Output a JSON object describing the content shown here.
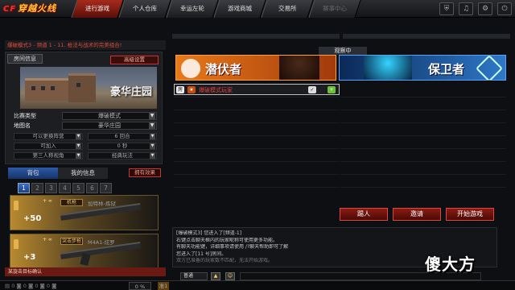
{
  "top_nav": {
    "logo": "穿越火线",
    "tabs": [
      "进行游戏",
      "个人仓库",
      "幸运左轮",
      "游戏商城",
      "交易所",
      "赛事中心"
    ],
    "active_tab": 0,
    "icons": [
      "shield-icon",
      "bell-icon",
      "gear-icon",
      "power-icon"
    ]
  },
  "mode_bar": "爆破模式3 - 频道 1 - 11. 枪法与战术的完美组合!",
  "room": {
    "info_label": "房间信息",
    "advanced_label": "高级设置",
    "map_name": "豪华庄园",
    "rows": [
      {
        "label": "比赛类型",
        "value": "爆破模式"
      },
      {
        "label": "地图名",
        "value": "豪华庄园"
      }
    ],
    "options": [
      [
        "可以更换阵营",
        "6 回合"
      ],
      [
        "可加入",
        "0 秒"
      ],
      [
        "第三人称视角",
        "经典玩法"
      ]
    ]
  },
  "bag": {
    "tab_bag": "背包",
    "tab_myinfo": "我的信息",
    "own_effects": "拥有效果",
    "pages": [
      "1",
      "2",
      "3",
      "4",
      "5",
      "6",
      "7"
    ],
    "active_page": 0,
    "items": [
      {
        "count": "+50",
        "tag": "机枪",
        "name": "加特林-炼狱",
        "plus": "+ ∞"
      },
      {
        "count": "+3",
        "tag": "突击步枪",
        "name": "M4A1-炫罗",
        "plus": "+ ∞"
      }
    ]
  },
  "status_strip": "某旋击目标确认",
  "bottom_bar": {
    "pct": "0 %",
    "rank": "准1"
  },
  "teams": {
    "spectator": "观察中",
    "t_name": "潜伏者",
    "ct_name": "保卫者"
  },
  "player": {
    "host_icon": "房",
    "rank_icon": "★",
    "name": "爆破模式玩家",
    "ready_icon": "✓",
    "add_icon": "+"
  },
  "actions": {
    "kick": "踢人",
    "invite": "邀请",
    "start": "开始游戏"
  },
  "chat": {
    "lines": [
      "[爆破模式3] 您进入了[频道-1]",
      "右键点击聊天框内的玩家昵称可使用更多功能。",
      "有聊天功能键，详细事项请使用 /?聊天帮助即可了解",
      "您进入了[11 号]房间。",
      "双方已准备的玩家数不匹配，无法开始游戏。"
    ],
    "channel": "普通"
  },
  "watermark": "傻大方"
}
